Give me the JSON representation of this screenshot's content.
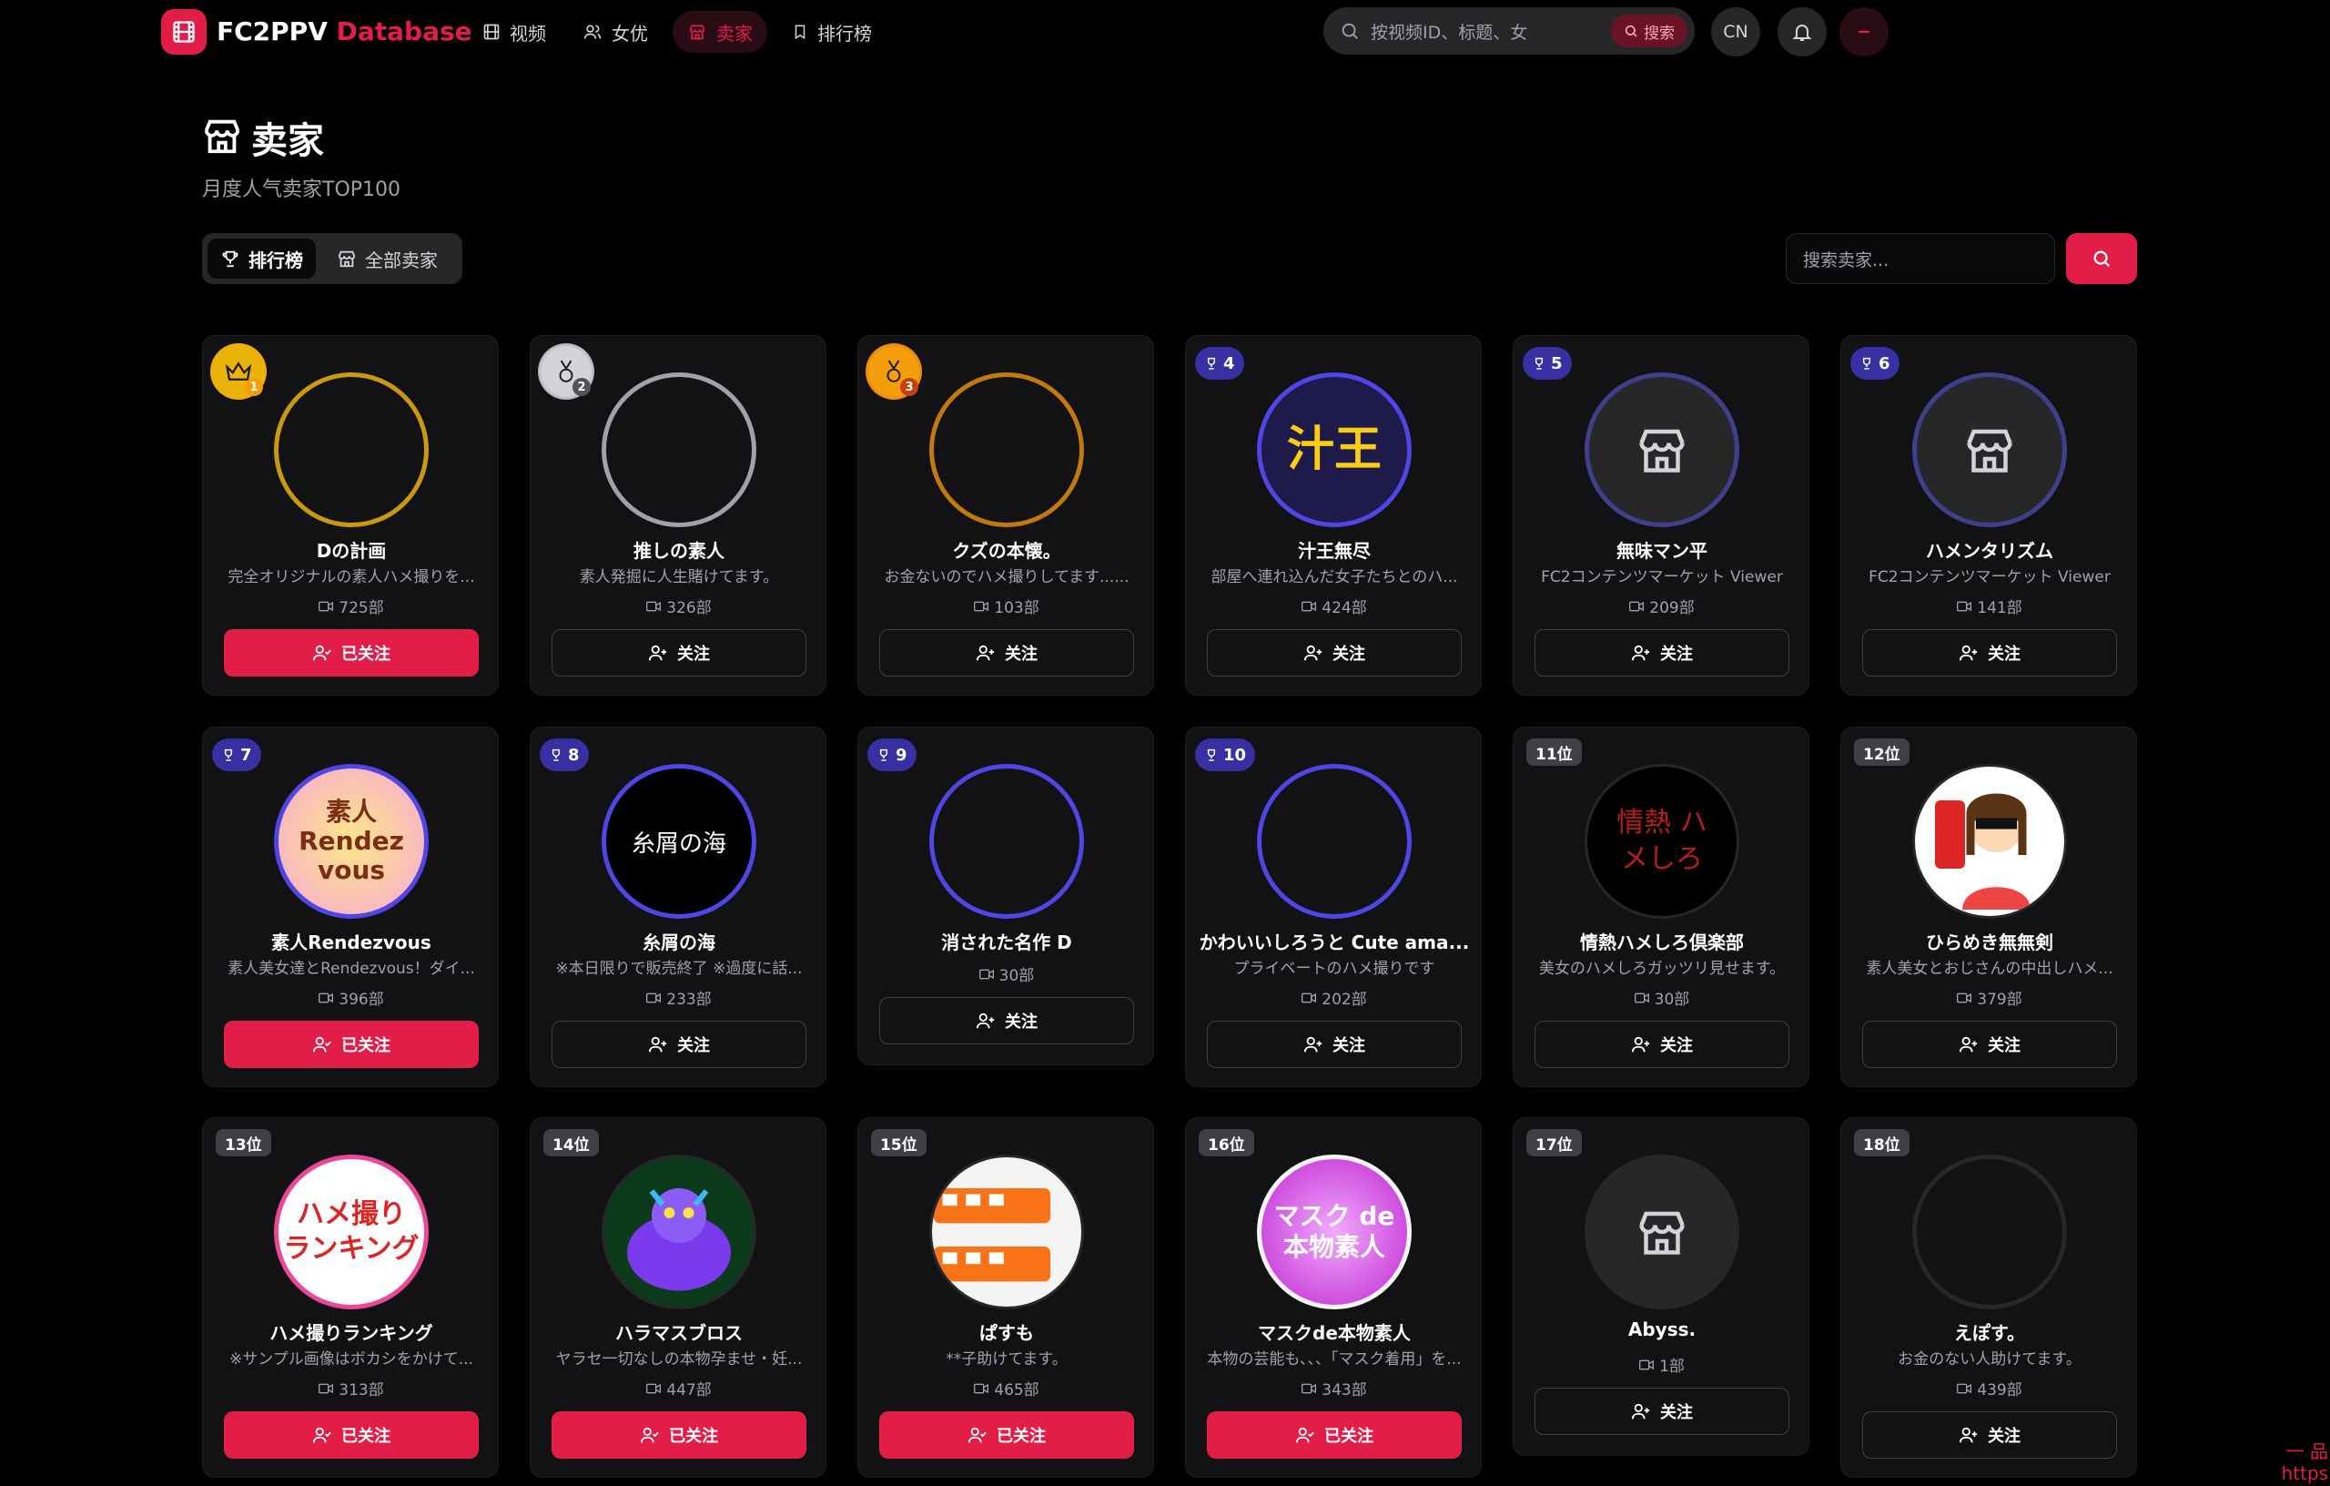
{
  "nav": {
    "brand_main": "FC2PPV",
    "brand_accent": "Database",
    "items": [
      {
        "label": "视频",
        "icon": "film-icon"
      },
      {
        "label": "女优",
        "icon": "users-icon"
      },
      {
        "label": "卖家",
        "icon": "store-icon",
        "active": true
      },
      {
        "label": "排行榜",
        "icon": "bookmark-icon"
      }
    ],
    "search_placeholder": "按视频ID、标题、女",
    "search_button": "搜索",
    "lang": "CN",
    "accent": "#e11d48"
  },
  "header": {
    "title": "卖家",
    "subtitle": "月度人气卖家TOP100"
  },
  "tabs": [
    {
      "label": "排行榜",
      "active": true
    },
    {
      "label": "全部卖家",
      "active": false
    }
  ],
  "seller_search_placeholder": "搜索卖家...",
  "sellers": [
    {
      "rank": "1",
      "badge": "gold",
      "name": "Dの計画",
      "desc": "完全オリジナルの素人ハメ撮りを...",
      "count": "725部",
      "follow": "已关注",
      "followed": true,
      "avatar": "empty-gold"
    },
    {
      "rank": "2",
      "badge": "silver",
      "name": "推しの素人",
      "desc": "素人発掘に人生賭けてます。",
      "count": "326部",
      "follow": "关注",
      "followed": false,
      "avatar": "empty-silver"
    },
    {
      "rank": "3",
      "badge": "bronze",
      "name": "クズの本懐。",
      "desc": "お金ないのでハメ撮りしてます......",
      "count": "103部",
      "follow": "关注",
      "followed": false,
      "avatar": "empty-bronze"
    },
    {
      "rank": "4",
      "badge": "blue",
      "name": "汁王無尽",
      "desc": "部屋へ連れ込んだ女子たちとのハ...",
      "count": "424部",
      "follow": "关注",
      "followed": false,
      "avatar": "shiruou",
      "avatar_text": "汁王"
    },
    {
      "rank": "5",
      "badge": "blue",
      "name": "無味マン平",
      "desc": "FC2コンテンツマーケット Viewer",
      "count": "209部",
      "follow": "关注",
      "followed": false,
      "avatar": "store"
    },
    {
      "rank": "6",
      "badge": "blue",
      "name": "ハメンタリズム",
      "desc": "FC2コンテンツマーケット Viewer",
      "count": "141部",
      "follow": "关注",
      "followed": false,
      "avatar": "store"
    },
    {
      "rank": "7",
      "badge": "blue",
      "name": "素人Rendezvous",
      "desc": "素人美女達とRendezvous！ダイ...",
      "count": "396部",
      "follow": "已关注",
      "followed": true,
      "avatar": "rendez",
      "avatar_text": "素人 Rendez vous"
    },
    {
      "rank": "8",
      "badge": "blue",
      "name": "糸屑の海",
      "desc": "※本日限りで販売終了 ※過度に話...",
      "count": "233部",
      "follow": "关注",
      "followed": false,
      "avatar": "itokuzu",
      "avatar_text": "糸屑の海"
    },
    {
      "rank": "9",
      "badge": "blue",
      "name": "消された名作 D",
      "desc": "",
      "count": "30部",
      "follow": "关注",
      "followed": false,
      "avatar": "empty-blue"
    },
    {
      "rank": "10",
      "badge": "blue",
      "name": "かわいいしろうと Cute ama...",
      "desc": "プライベートのハメ撮りです",
      "count": "202部",
      "follow": "关注",
      "followed": false,
      "avatar": "empty-blue"
    },
    {
      "rank": "11位",
      "badge": "gray",
      "name": "情熱ハメしろ倶楽部",
      "desc": "美女のハメしろガッツリ見せます。",
      "count": "30部",
      "follow": "关注",
      "followed": false,
      "avatar": "jounetsu",
      "avatar_text": "情熱 ハメしろ"
    },
    {
      "rank": "12位",
      "badge": "gray",
      "name": "ひらめき無無剣",
      "desc": "素人美女とおじさんの中出しハメ...",
      "count": "379部",
      "follow": "关注",
      "followed": false,
      "avatar": "hirameki"
    },
    {
      "rank": "13位",
      "badge": "gray",
      "name": "ハメ撮りランキング",
      "desc": "※サンプル画像はボカシをかけて...",
      "count": "313部",
      "follow": "已关注",
      "followed": true,
      "avatar": "hameranking",
      "avatar_text": "ハメ撮り ランキング"
    },
    {
      "rank": "14位",
      "badge": "gray",
      "name": "ハラマスブロス",
      "desc": "ヤラセ一切なしの本物孕ませ・妊...",
      "count": "447部",
      "follow": "已关注",
      "followed": true,
      "avatar": "monster"
    },
    {
      "rank": "15位",
      "badge": "gray",
      "name": "ぱすも",
      "desc": "**子助けてます。",
      "count": "465部",
      "follow": "已关注",
      "followed": true,
      "avatar": "train"
    },
    {
      "rank": "16位",
      "badge": "gray",
      "name": "マスクde本物素人",
      "desc": "本物の芸能も、、、「マスク着用」を...",
      "count": "343部",
      "follow": "已关注",
      "followed": true,
      "avatar": "mask",
      "avatar_text": "マスク de 本物素人"
    },
    {
      "rank": "17位",
      "badge": "gray",
      "name": "Abyss.",
      "desc": "",
      "count": "1部",
      "follow": "关注",
      "followed": false,
      "avatar": "store-dark"
    },
    {
      "rank": "18位",
      "badge": "gray",
      "name": "えぽす。",
      "desc": "お金のない人助けてます。",
      "count": "439部",
      "follow": "关注",
      "followed": false,
      "avatar": "empty-dark"
    }
  ],
  "watermark": {
    "line1": "一 品",
    "line2": "https"
  }
}
